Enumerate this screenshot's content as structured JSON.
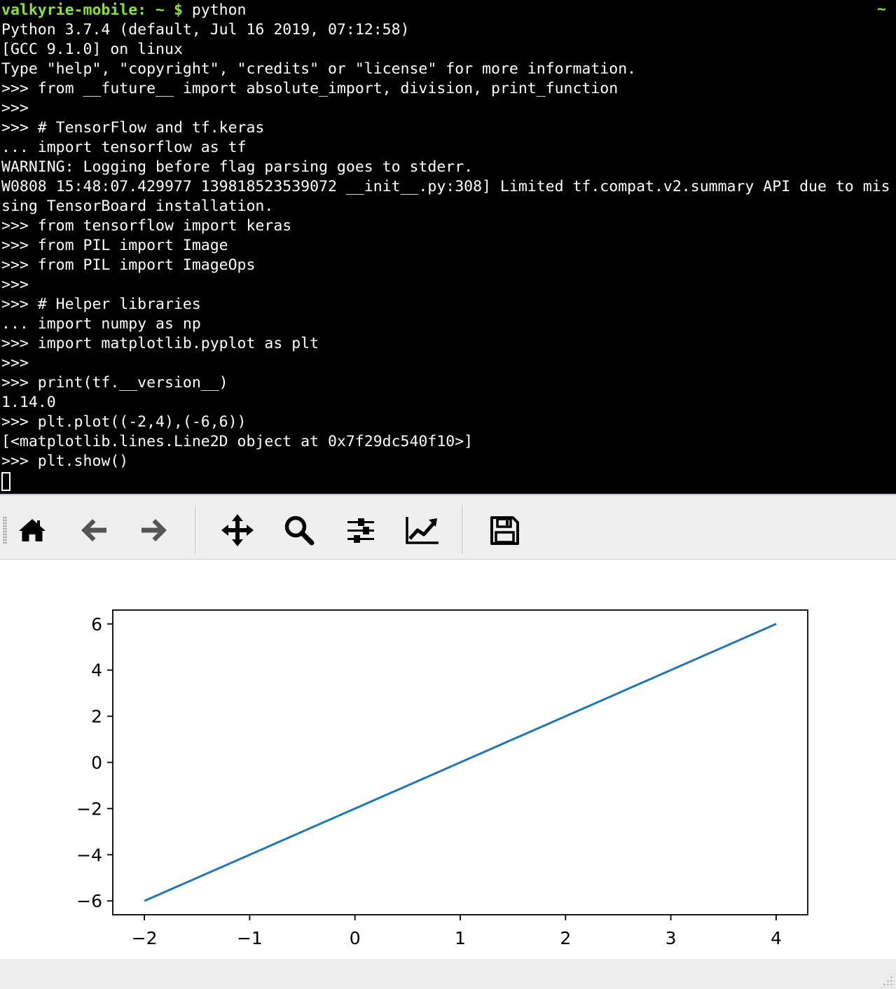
{
  "terminal": {
    "prompt_host": "valkyrie-mobile: ~ $",
    "prompt_command": " python",
    "corner_indicator": "~",
    "lines": [
      "Python 3.7.4 (default, Jul 16 2019, 07:12:58)",
      "[GCC 9.1.0] on linux",
      "Type \"help\", \"copyright\", \"credits\" or \"license\" for more information.",
      ">>> from __future__ import absolute_import, division, print_function",
      ">>>",
      ">>> # TensorFlow and tf.keras",
      "... import tensorflow as tf",
      "WARNING: Logging before flag parsing goes to stderr.",
      "W0808 15:48:07.429977 139818523539072 __init__.py:308] Limited tf.compat.v2.summary API due to mis",
      "sing TensorBoard installation.",
      ">>> from tensorflow import keras",
      ">>> from PIL import Image",
      ">>> from PIL import ImageOps",
      ">>>",
      ">>> # Helper libraries",
      "... import numpy as np",
      ">>> import matplotlib.pyplot as plt",
      ">>>",
      ">>> print(tf.__version__)",
      "1.14.0",
      ">>> plt.plot((-2,4),(-6,6))",
      "[<matplotlib.lines.Line2D object at 0x7f29dc540f10>]",
      ">>> plt.show()"
    ]
  },
  "toolbar": {
    "buttons": [
      {
        "name": "home-button",
        "icon": "home-icon"
      },
      {
        "name": "back-button",
        "icon": "arrow-left-icon"
      },
      {
        "name": "forward-button",
        "icon": "arrow-right-icon"
      },
      {
        "name": "pan-button",
        "icon": "move-icon"
      },
      {
        "name": "zoom-button",
        "icon": "magnifier-icon"
      },
      {
        "name": "subplots-button",
        "icon": "sliders-icon"
      },
      {
        "name": "edit-axis-button",
        "icon": "line-chart-icon"
      },
      {
        "name": "save-button",
        "icon": "floppy-disk-icon"
      }
    ]
  },
  "colors": {
    "terminal_bg": "#000000",
    "terminal_fg": "#ffffff",
    "prompt_green": "#8ae234",
    "line_color": "#1f77b4"
  },
  "chart_data": {
    "type": "line",
    "title": "",
    "xlabel": "",
    "ylabel": "",
    "x": [
      -2,
      4
    ],
    "series": [
      {
        "values": [
          -6,
          6
        ]
      }
    ],
    "xlim": [
      -2.3,
      4.3
    ],
    "ylim": [
      -6.6,
      6.6
    ],
    "xticks": [
      -2,
      -1,
      0,
      1,
      2,
      3,
      4
    ],
    "yticks": [
      -6,
      -4,
      -2,
      0,
      2,
      4,
      6
    ],
    "xtick_labels": [
      "−2",
      "−1",
      "0",
      "1",
      "2",
      "3",
      "4"
    ],
    "ytick_labels": [
      "−6",
      "−4",
      "−2",
      "0",
      "2",
      "4",
      "6"
    ],
    "grid": false,
    "legend": "none"
  }
}
